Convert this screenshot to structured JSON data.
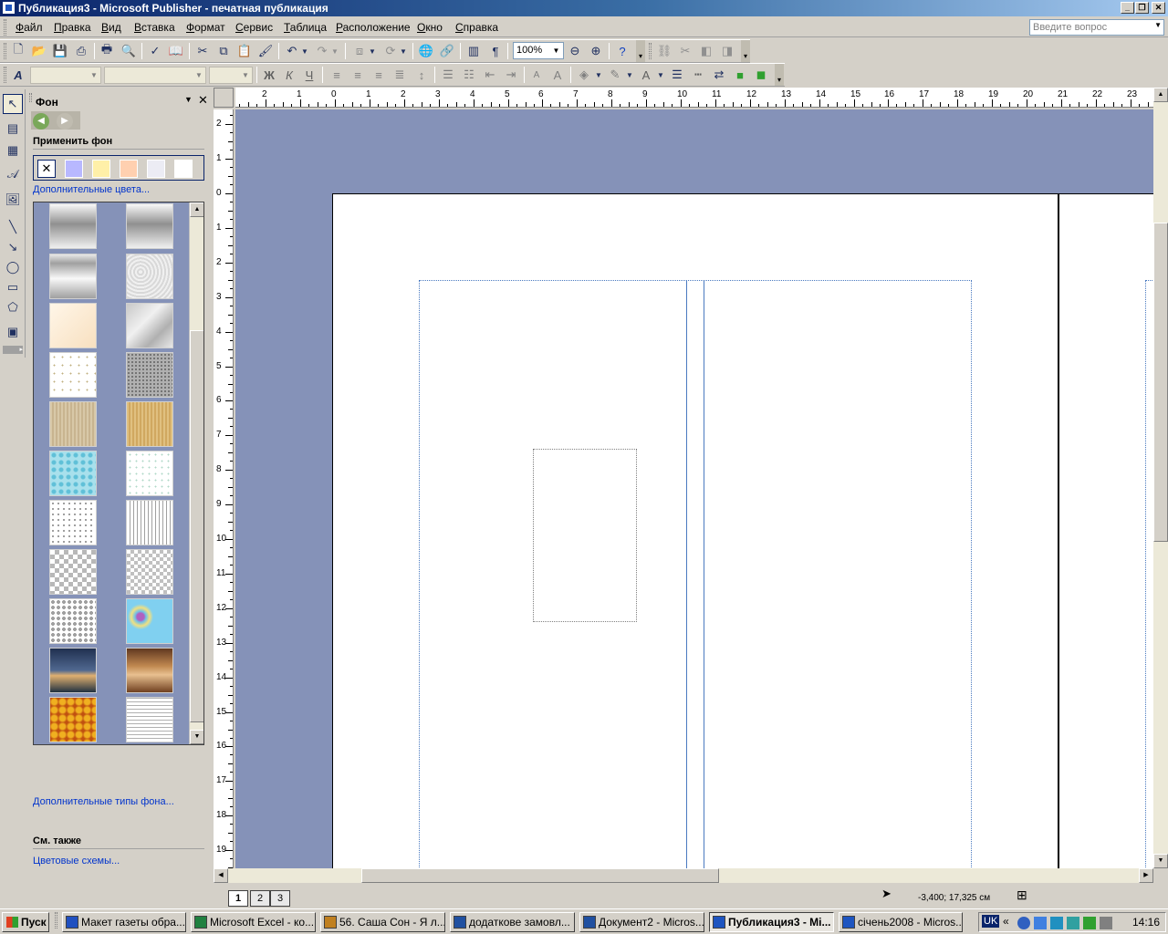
{
  "window": {
    "title": "Публикация3 - Microsoft Publisher - печатная публикация"
  },
  "menu": {
    "items": [
      "Файл",
      "Правка",
      "Вид",
      "Вставка",
      "Формат",
      "Сервис",
      "Таблица",
      "Расположение",
      "Окно",
      "Справка"
    ],
    "ask_placeholder": "Введите вопрос"
  },
  "toolbar": {
    "zoom": "100%",
    "icons": [
      "new-icon",
      "open-icon",
      "save-icon",
      "print-icon",
      "print-preview-icon",
      "spelling-icon",
      "research-icon",
      "cut-icon",
      "copy-icon",
      "paste-icon",
      "format-painter-icon",
      "undo-icon",
      "redo-icon",
      "bring-to-front-icon",
      "rotate-icon",
      "web-icon",
      "insert-hyperlink-icon",
      "columns-icon",
      "pilcrow-icon",
      "zoom-out-icon",
      "zoom-in-icon",
      "help-icon"
    ]
  },
  "format_toolbar": {
    "bold": "Ж",
    "italic": "К",
    "underline": "Ч"
  },
  "task_pane": {
    "title": "Фон",
    "apply_heading": "Применить фон",
    "more_colors": "Дополнительные цвета...",
    "swatches": [
      "#ffffff",
      "#b8b8ff",
      "#fff0a8",
      "#ffd0b0",
      "#ececf4",
      "#ffffff"
    ],
    "more_types": "Дополнительные типы фона...",
    "see_also": "См. также",
    "color_schemes": "Цветовые схемы..."
  },
  "ruler": {
    "horizontal": [
      "2",
      "1",
      "0",
      "1",
      "2",
      "3",
      "4",
      "5",
      "6",
      "7",
      "8",
      "9",
      "10",
      "11",
      "12",
      "13",
      "14",
      "15",
      "16",
      "17",
      "18",
      "19",
      "20",
      "21",
      "22",
      "23"
    ],
    "vertical": [
      "2",
      "1",
      "0",
      "1",
      "2",
      "3",
      "4",
      "5",
      "6",
      "7",
      "8",
      "9",
      "10",
      "11",
      "12",
      "13",
      "14",
      "15",
      "16",
      "17",
      "18",
      "19"
    ]
  },
  "status": {
    "pages": [
      "1",
      "2",
      "3"
    ],
    "coordinates": "-3,400; 17,325 см"
  },
  "taskbar": {
    "start": "Пуск",
    "tasks": [
      {
        "label": "Макет газеты обра...",
        "color": "#2050c0",
        "active": false
      },
      {
        "label": "Microsoft Excel - ко...",
        "color": "#208040",
        "active": false
      },
      {
        "label": "56. Саша Сон - Я л...",
        "color": "#c08020",
        "active": false
      },
      {
        "label": "додаткове замовл...",
        "color": "#2050a0",
        "active": false
      },
      {
        "label": "Документ2 - Micros...",
        "color": "#2050a0",
        "active": false
      },
      {
        "label": "Публикация3 - Mi...",
        "color": "#1e55c0",
        "active": true
      },
      {
        "label": "січень2008 - Micros...",
        "color": "#1e55c0",
        "active": false
      }
    ],
    "tray_lang": "UK",
    "clock": "14:16"
  }
}
